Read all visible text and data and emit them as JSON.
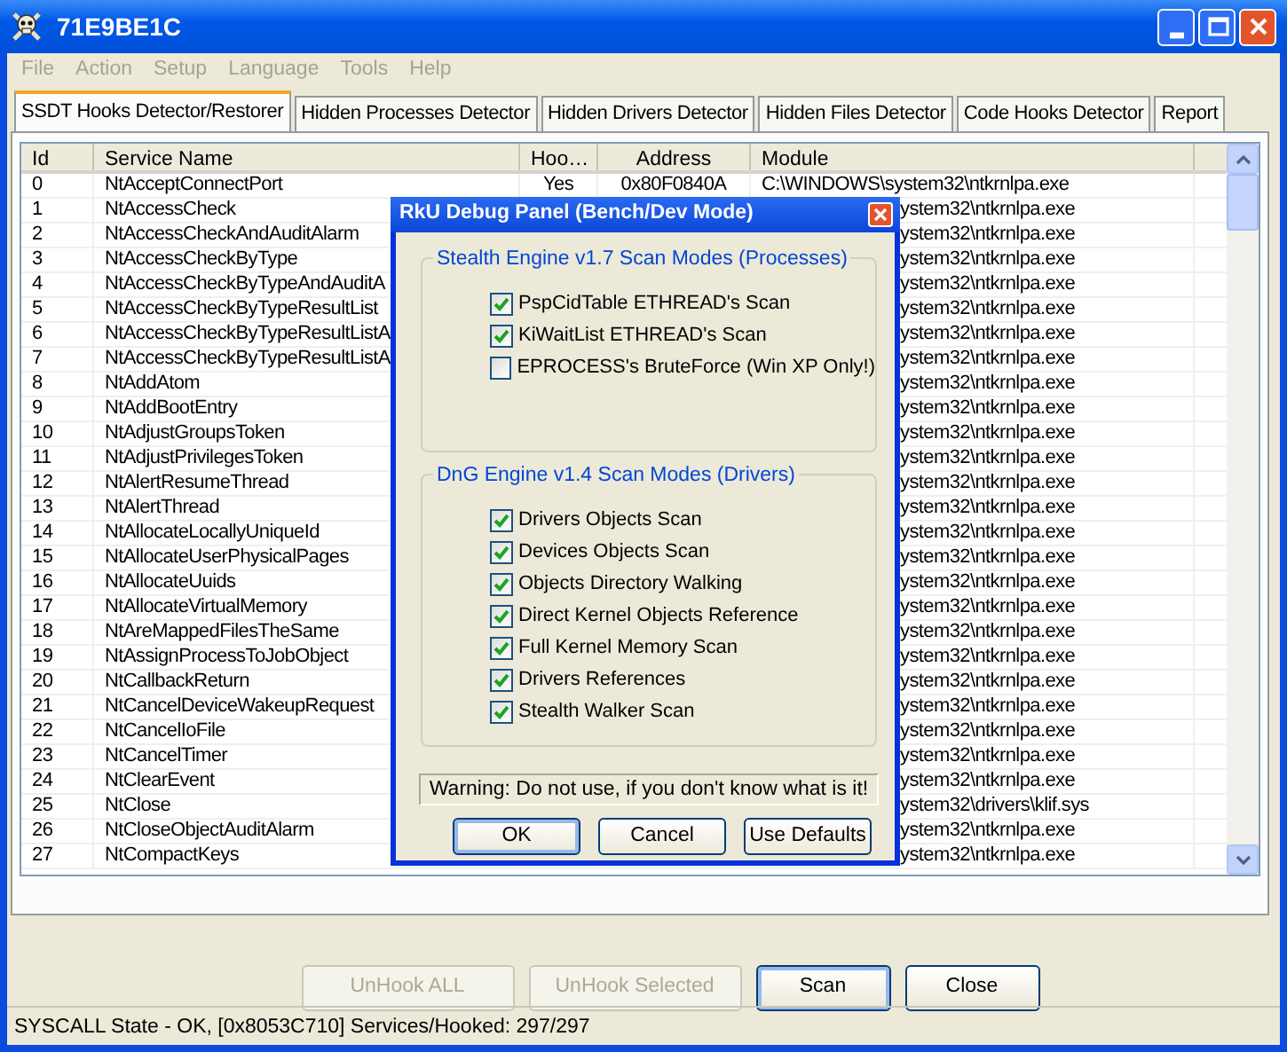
{
  "window": {
    "title": "71E9BE1C"
  },
  "menu": [
    "File",
    "Action",
    "Setup",
    "Language",
    "Tools",
    "Help"
  ],
  "tabs": [
    {
      "label": "SSDT Hooks Detector/Restorer",
      "selected": true
    },
    {
      "label": "Hidden Processes Detector",
      "selected": false
    },
    {
      "label": "Hidden Drivers Detector",
      "selected": false
    },
    {
      "label": "Hidden Files Detector",
      "selected": false
    },
    {
      "label": "Code Hooks Detector",
      "selected": false
    },
    {
      "label": "Report",
      "selected": false
    }
  ],
  "table": {
    "columns": [
      "Id",
      "Service Name",
      "Hoo…",
      "Address",
      "Module"
    ],
    "rows": [
      {
        "id": "0",
        "service": "NtAcceptConnectPort",
        "hook": "Yes",
        "address": "0x80F0840A",
        "module": "C:\\WINDOWS\\system32\\ntkrnlpa.exe"
      },
      {
        "id": "1",
        "service": "NtAccessCheck",
        "module": "ystem32\\ntkrnlpa.exe"
      },
      {
        "id": "2",
        "service": "NtAccessCheckAndAuditAlarm",
        "module": "ystem32\\ntkrnlpa.exe"
      },
      {
        "id": "3",
        "service": "NtAccessCheckByType",
        "module": "ystem32\\ntkrnlpa.exe"
      },
      {
        "id": "4",
        "service": "NtAccessCheckByTypeAndAuditA",
        "module": "ystem32\\ntkrnlpa.exe"
      },
      {
        "id": "5",
        "service": "NtAccessCheckByTypeResultList",
        "module": "ystem32\\ntkrnlpa.exe"
      },
      {
        "id": "6",
        "service": "NtAccessCheckByTypeResultListA",
        "module": "ystem32\\ntkrnlpa.exe"
      },
      {
        "id": "7",
        "service": "NtAccessCheckByTypeResultListA",
        "module": "ystem32\\ntkrnlpa.exe"
      },
      {
        "id": "8",
        "service": "NtAddAtom",
        "module": "ystem32\\ntkrnlpa.exe"
      },
      {
        "id": "9",
        "service": "NtAddBootEntry",
        "module": "ystem32\\ntkrnlpa.exe"
      },
      {
        "id": "10",
        "service": "NtAdjustGroupsToken",
        "module": "ystem32\\ntkrnlpa.exe"
      },
      {
        "id": "11",
        "service": "NtAdjustPrivilegesToken",
        "module": "ystem32\\ntkrnlpa.exe"
      },
      {
        "id": "12",
        "service": "NtAlertResumeThread",
        "module": "ystem32\\ntkrnlpa.exe"
      },
      {
        "id": "13",
        "service": "NtAlertThread",
        "module": "ystem32\\ntkrnlpa.exe"
      },
      {
        "id": "14",
        "service": "NtAllocateLocallyUniqueId",
        "module": "ystem32\\ntkrnlpa.exe"
      },
      {
        "id": "15",
        "service": "NtAllocateUserPhysicalPages",
        "module": "ystem32\\ntkrnlpa.exe"
      },
      {
        "id": "16",
        "service": "NtAllocateUuids",
        "module": "ystem32\\ntkrnlpa.exe"
      },
      {
        "id": "17",
        "service": "NtAllocateVirtualMemory",
        "module": "ystem32\\ntkrnlpa.exe"
      },
      {
        "id": "18",
        "service": "NtAreMappedFilesTheSame",
        "module": "ystem32\\ntkrnlpa.exe"
      },
      {
        "id": "19",
        "service": "NtAssignProcessToJobObject",
        "module": "ystem32\\ntkrnlpa.exe"
      },
      {
        "id": "20",
        "service": "NtCallbackReturn",
        "module": "ystem32\\ntkrnlpa.exe"
      },
      {
        "id": "21",
        "service": "NtCancelDeviceWakeupRequest",
        "module": "ystem32\\ntkrnlpa.exe"
      },
      {
        "id": "22",
        "service": "NtCancelIoFile",
        "module": "ystem32\\ntkrnlpa.exe"
      },
      {
        "id": "23",
        "service": "NtCancelTimer",
        "module": "ystem32\\ntkrnlpa.exe"
      },
      {
        "id": "24",
        "service": "NtClearEvent",
        "module": "ystem32\\ntkrnlpa.exe"
      },
      {
        "id": "25",
        "service": "NtClose",
        "module": "ystem32\\drivers\\klif.sys"
      },
      {
        "id": "26",
        "service": "NtCloseObjectAuditAlarm",
        "module": "ystem32\\ntkrnlpa.exe"
      },
      {
        "id": "27",
        "service": "NtCompactKeys",
        "module": "ystem32\\ntkrnlpa.exe"
      }
    ]
  },
  "buttons": [
    {
      "label": "UnHook ALL",
      "disabled": true,
      "focused": false
    },
    {
      "label": "UnHook Selected",
      "disabled": true,
      "focused": false
    },
    {
      "label": "Scan",
      "disabled": false,
      "focused": true
    },
    {
      "label": "Close",
      "disabled": false,
      "focused": false
    }
  ],
  "status_bar": "SYSCALL State - OK,  [0x8053C710]  Services/Hooked: 297/297",
  "dialog": {
    "title": "RkU Debug Panel (Bench/Dev Mode)",
    "groups": [
      {
        "title": "Stealth Engine v1.7 Scan Modes (Processes)",
        "options": [
          {
            "label": "PspCidTable ETHREAD's Scan",
            "checked": true
          },
          {
            "label": "KiWaitList ETHREAD's Scan",
            "checked": true
          },
          {
            "label": "EPROCESS's BruteForce (Win XP Only!)",
            "checked": false
          }
        ]
      },
      {
        "title": "DnG Engine v1.4 Scan Modes (Drivers)",
        "options": [
          {
            "label": "Drivers Objects Scan",
            "checked": true
          },
          {
            "label": "Devices Objects Scan",
            "checked": true
          },
          {
            "label": "Objects Directory Walking",
            "checked": true
          },
          {
            "label": "Direct Kernel Objects Reference",
            "checked": true
          },
          {
            "label": "Full Kernel Memory Scan",
            "checked": true
          },
          {
            "label": "Drivers References",
            "checked": true
          },
          {
            "label": "Stealth Walker Scan",
            "checked": true
          }
        ]
      }
    ],
    "warning": "Warning: Do not use, if you don't know what is it!",
    "buttons": [
      "OK",
      "Cancel",
      "Use Defaults"
    ]
  }
}
